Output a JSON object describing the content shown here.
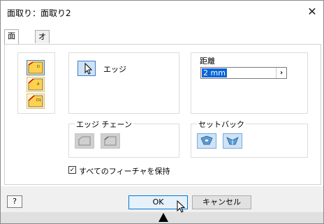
{
  "window": {
    "title": "面取り：面取り2",
    "close_glyph": "✕"
  },
  "tabs": [
    {
      "label": "面取り",
      "active": true
    },
    {
      "label": "オフセット",
      "active": false
    }
  ],
  "chamfer_modes": [
    {
      "icon": "chamfer-distance-icon",
      "selected": true
    },
    {
      "icon": "chamfer-distance-angle-icon",
      "selected": false
    },
    {
      "icon": "chamfer-two-distances-icon",
      "selected": false
    }
  ],
  "edge": {
    "label": "エッジ",
    "icon": "select-arrow-icon"
  },
  "distance": {
    "label": "距離",
    "value": "2 mm",
    "arrow": "›"
  },
  "edge_chain": {
    "label": "エッジ チェーン"
  },
  "setback": {
    "label": "セットバック"
  },
  "preserve": {
    "label": "すべてのフィーチャを保持",
    "checked": true,
    "check_glyph": "✓"
  },
  "footer": {
    "help": "?",
    "ok": "OK",
    "cancel": "キャンセル"
  }
}
